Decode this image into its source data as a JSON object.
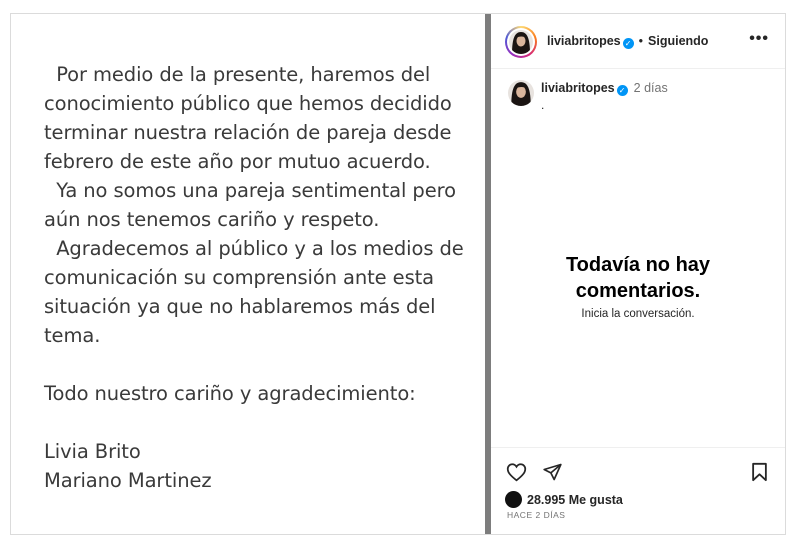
{
  "post": {
    "statement_lines": [
      "  Por medio de la presente, haremos del",
      "conocimiento público que hemos decidido",
      "terminar nuestra relación de pareja desde",
      "febrero de este año por mutuo acuerdo.",
      "  Ya no somos una pareja sentimental pero",
      "aún nos tenemos cariño y respeto.",
      "  Agradecemos al público y a los medios de",
      "comunicación su comprensión ante esta",
      "situación ya que no hablaremos más del",
      "tema.",
      "",
      "Todo nuestro cariño y agradecimiento:",
      "",
      "Livia Brito",
      "Mariano Martinez"
    ]
  },
  "header": {
    "username": "liviabritopes",
    "separator": "•",
    "follow_label": "Siguiendo",
    "more_icon": "more-horizontal-icon"
  },
  "caption": {
    "username": "liviabritopes",
    "time": "2 días",
    "text": "."
  },
  "comments": {
    "empty_title_line1": "Todavía no hay",
    "empty_title_line2": "comentarios.",
    "empty_subtitle": "Inicia la conversación."
  },
  "actions": {
    "like_icon": "heart-icon",
    "share_icon": "paper-plane-icon",
    "save_icon": "bookmark-icon"
  },
  "likes": {
    "count_text": "28.995 Me gusta"
  },
  "timestamp": "HACE 2 DÍAS",
  "colors": {
    "verified": "#0095f6",
    "divider": "#7d7d7d",
    "statement_text": "#3a3a3a"
  }
}
